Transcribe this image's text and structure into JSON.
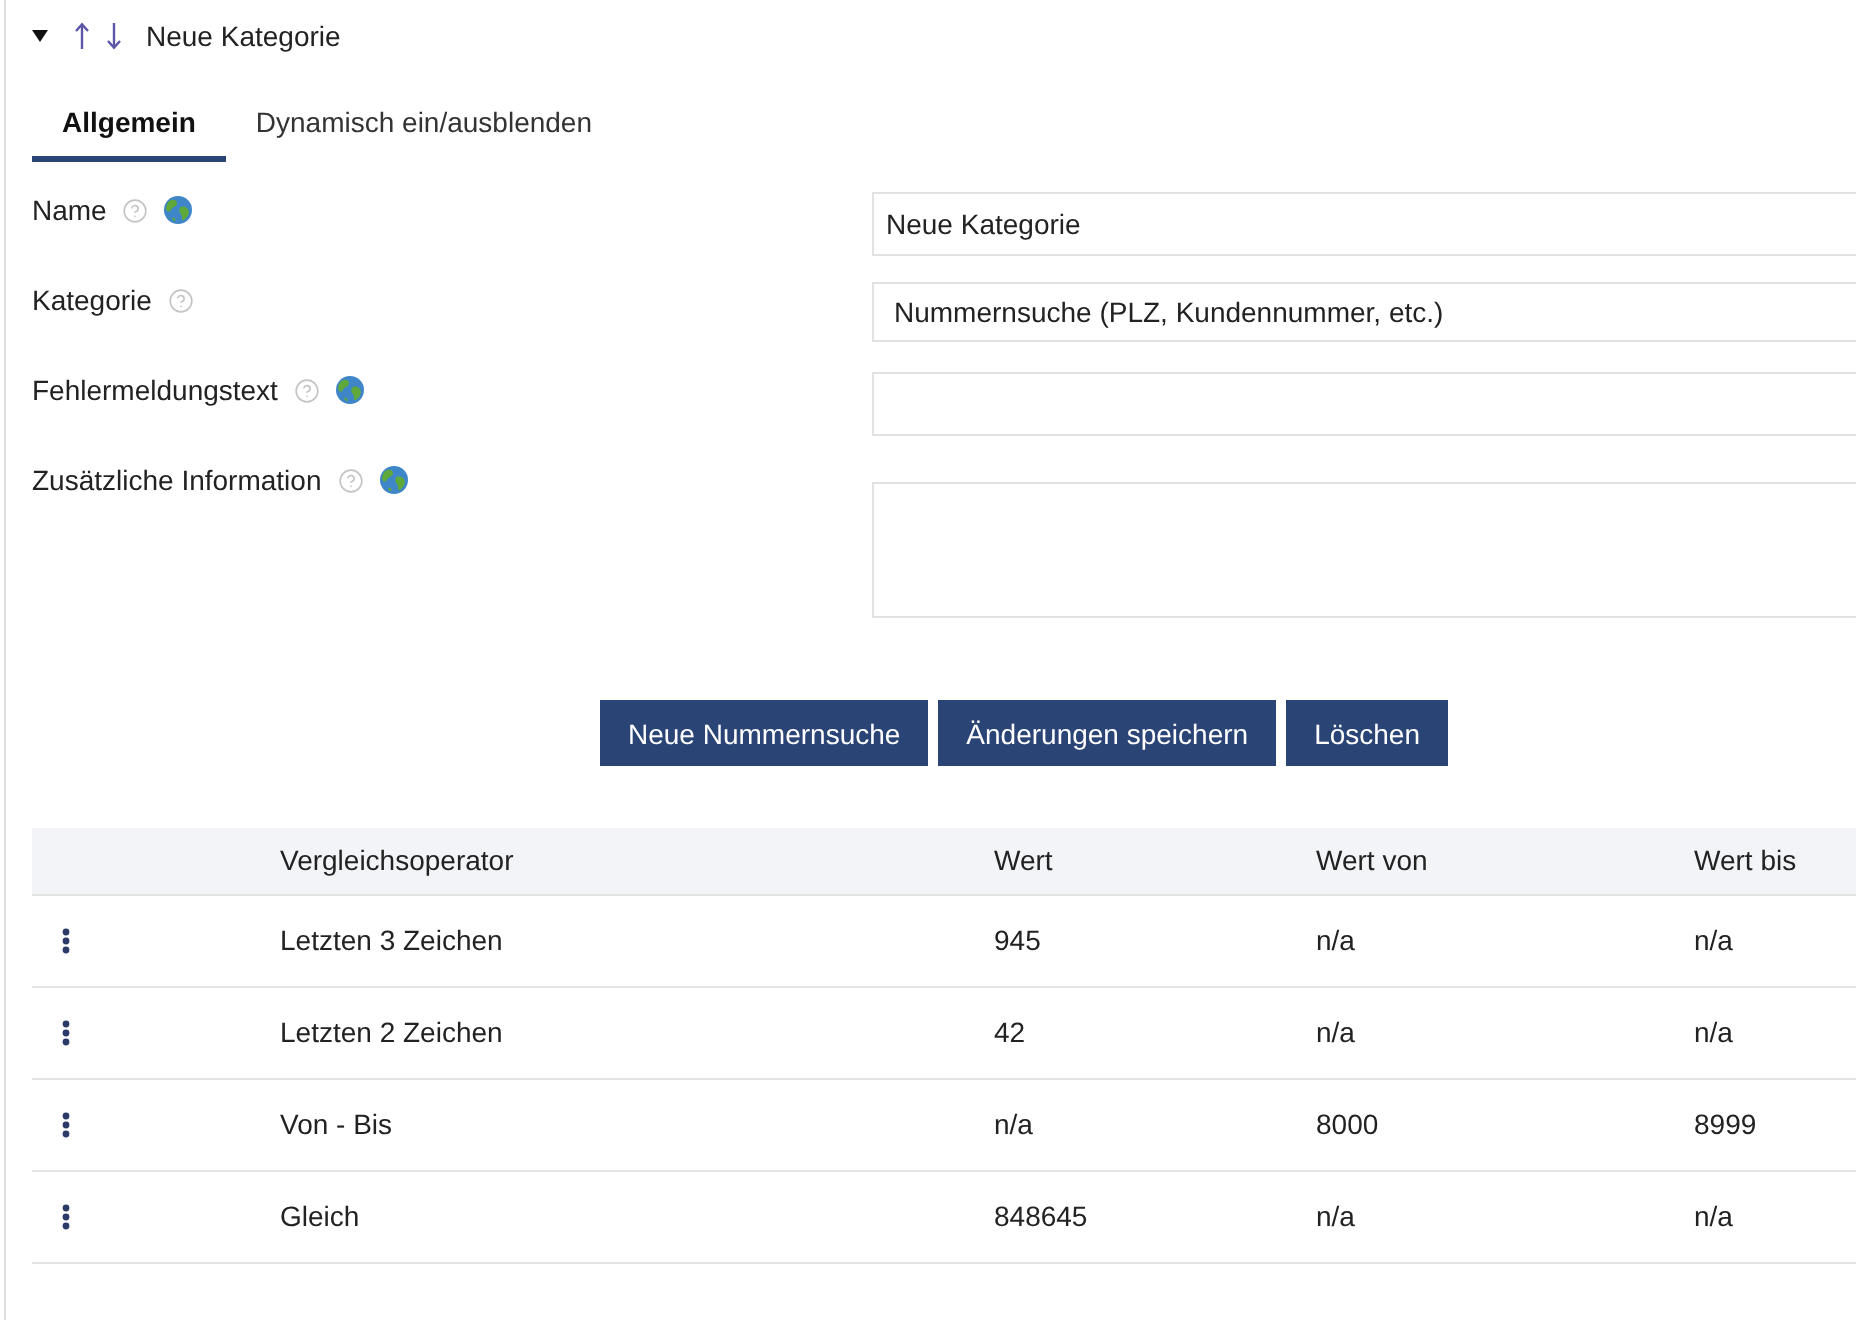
{
  "category": {
    "expanded": true,
    "title": "Neue Kategorie"
  },
  "tabs": [
    {
      "label": "Allgemein",
      "selected": true
    },
    {
      "label": "Dynamisch ein/ausblenden",
      "selected": false
    }
  ],
  "fields": [
    {
      "label": "Name",
      "kind": "input",
      "globe": true,
      "value": "Neue Kategorie"
    },
    {
      "label": "Kategorie",
      "kind": "select",
      "globe": false,
      "value": "Nummernsuche (PLZ, Kundennummer, etc.)"
    },
    {
      "label": "Fehlermeldungstext",
      "kind": "input",
      "globe": true
    },
    {
      "label": "Zusätzliche Information",
      "kind": "textarea",
      "globe": true
    }
  ],
  "buttons": [
    "Neue Nummernsuche",
    "Änderungen speichern",
    "Löschen"
  ],
  "table": {
    "columns": [
      "Vergleichsoperator",
      "Wert",
      "Wert von",
      "Wert bis"
    ],
    "rows": [
      [
        "Letzten 3 Zeichen",
        "945",
        "n/a",
        "n/a"
      ],
      [
        "Letzten 2 Zeichen",
        "42",
        "n/a",
        "n/a"
      ],
      [
        "Von - Bis",
        "n/a",
        "8000",
        "8999"
      ],
      [
        "Gleich",
        "848645",
        "n/a",
        "n/a"
      ]
    ]
  }
}
